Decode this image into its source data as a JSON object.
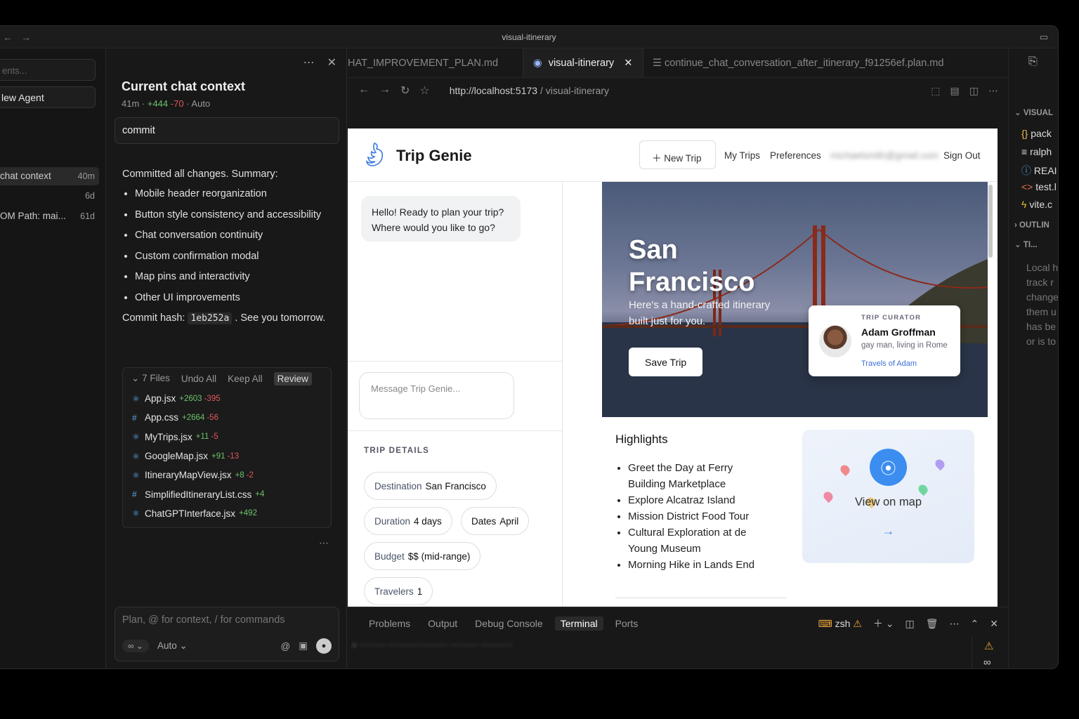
{
  "window": {
    "title": "visual-itinerary"
  },
  "left_strip": {
    "search_placeholder": "ents...",
    "new_agent": "lew Agent",
    "items": [
      {
        "label": "chat context",
        "time": "40m"
      },
      {
        "label": "",
        "time": "6d"
      },
      {
        "label": "OM Path: mai...",
        "time": "61d"
      }
    ]
  },
  "chat": {
    "title": "Current chat context",
    "meta_time": "41m ·",
    "meta_add": "+444",
    "meta_del": "-70",
    "meta_mode": "· Auto",
    "commit_label": "commit",
    "summary_intro": "Committed all changes. Summary:",
    "bullets": [
      "Mobile header reorganization",
      "Button style consistency and accessibility",
      "Chat conversation continuity",
      "Custom confirmation modal",
      "Map pins and interactivity",
      "Other UI improvements"
    ],
    "hash_pre": "Commit hash:",
    "hash": "1eb252a",
    "hash_post": ". See you tomorrow.",
    "files_count": "7 Files",
    "undo_all": "Undo All",
    "keep_all": "Keep All",
    "review": "Review",
    "files": [
      {
        "icon": "react-icon",
        "name": "App.jsx",
        "add": "+2603",
        "del": "-395"
      },
      {
        "icon": "hash-icon",
        "name": "App.css",
        "add": "+2664",
        "del": "-56"
      },
      {
        "icon": "react-icon",
        "name": "MyTrips.jsx",
        "add": "+11",
        "del": "-5"
      },
      {
        "icon": "react-icon",
        "name": "GoogleMap.jsx",
        "add": "+91",
        "del": "-13"
      },
      {
        "icon": "react-icon",
        "name": "ItineraryMapView.jsx",
        "add": "+8",
        "del": "-2"
      },
      {
        "icon": "hash-icon",
        "name": "SimplifiedItineraryList.css",
        "add": "+4",
        "del": ""
      },
      {
        "icon": "react-icon",
        "name": "ChatGPTInterface.jsx",
        "add": "+492",
        "del": ""
      }
    ],
    "composer_placeholder": "Plan, @ for context, / for commands",
    "mode": "Auto"
  },
  "editor": {
    "tabs": [
      {
        "label": "HAT_IMPROVEMENT_PLAN.md"
      },
      {
        "label": "visual-itinerary"
      },
      {
        "label": "continue_chat_conversation_after_itinerary_f91256ef.plan.md"
      }
    ],
    "url_host": "http://localhost:5173",
    "url_path": " / visual-itinerary"
  },
  "app": {
    "brand": "Trip Genie",
    "new_trip": "New Trip",
    "my_trips": "My Trips",
    "preferences": "Preferences",
    "email": "michaelsmith@gmail.com",
    "sign_out": "Sign Out",
    "greeting": "Hello! Ready to plan your trip? Where would you like to go?",
    "message_placeholder": "Message Trip Genie...",
    "trip_details_title": "TRIP DETAILS",
    "details": [
      {
        "k": "Destination",
        "v": "San Francisco"
      },
      {
        "k": "Duration",
        "v": "4 days"
      },
      {
        "k": "Dates",
        "v": "April"
      },
      {
        "k": "Budget",
        "v": "$$ (mid-range)"
      },
      {
        "k": "Travelers",
        "v": "1"
      }
    ],
    "hero_title_1": "San",
    "hero_title_2": "Francisco",
    "hero_sub": "Here's a hand-crafted itinerary built just for you.",
    "save_trip": "Save Trip",
    "curator_label": "TRIP CURATOR",
    "curator_name": "Adam Groffman",
    "curator_desc": "gay man, living in Rome",
    "curator_link": "Travels of Adam",
    "highlights_title": "Highlights",
    "highlights": [
      "Greet the Day at Ferry Building Marketplace",
      "Explore Alcatraz Island",
      "Mission District Food Tour",
      "Cultural Exploration at de Young Museum",
      "Morning Hike in Lands End"
    ],
    "view_on_map": "View on map"
  },
  "panel": {
    "tabs": [
      "Problems",
      "Output",
      "Debug Console",
      "Terminal",
      "Ports"
    ],
    "active_tab": "Terminal",
    "shell": "zsh"
  },
  "right_sidebar": {
    "section_visual": "VISUAL",
    "files": [
      "pack",
      "ralph",
      "REAI",
      "test.l",
      "vite.c"
    ],
    "section_outline": "OUTLIN",
    "section_timeline": "TI...",
    "note": "Local h track r change them u has be or is to"
  },
  "colors": {
    "add": "#6cc36c",
    "del": "#e0585a",
    "accent": "#3b8ef0",
    "warning": "#e8a23a"
  }
}
